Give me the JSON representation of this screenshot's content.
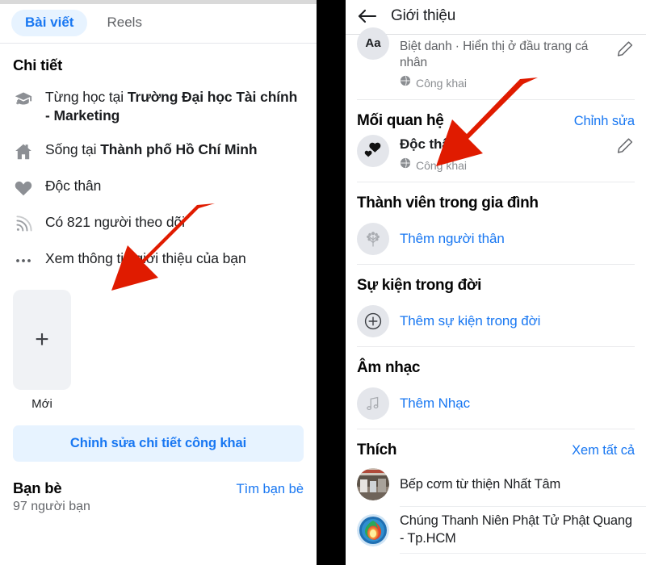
{
  "left": {
    "tabs": [
      {
        "label": "Bài viết",
        "active": true
      },
      {
        "label": "Reels",
        "active": false
      }
    ],
    "details_title": "Chi tiết",
    "details": [
      {
        "icon": "graduation-cap-icon",
        "prefix": "Từng học tại ",
        "strong": "Trường Đại học Tài chính - Marketing"
      },
      {
        "icon": "home-icon",
        "prefix": "Sống tại ",
        "strong": "Thành phố Hồ Chí Minh"
      },
      {
        "icon": "heart-icon",
        "prefix": "Độc thân",
        "strong": ""
      },
      {
        "icon": "rss-icon",
        "prefix": "Có 821 người theo dõi",
        "strong": ""
      },
      {
        "icon": "ellipsis-icon",
        "prefix": "Xem thông tin giới thiệu của bạn",
        "strong": ""
      }
    ],
    "new_card_label": "Mới",
    "edit_public_button": "Chỉnh sửa chi tiết công khai",
    "friends_title": "Bạn bè",
    "friends_count": "97 người bạn",
    "find_friends_link": "Tìm bạn bè"
  },
  "right": {
    "header_title": "Giới thiệu",
    "clipped_row": {
      "avatar_text": "Aa",
      "primary": "Biệt danh · Hiển thị ở đầu trang cá nhân",
      "privacy": "Công khai"
    },
    "relationship": {
      "title": "Mối quan hệ",
      "edit_link": "Chỉnh sửa",
      "status": "Độc thân",
      "privacy": "Công khai"
    },
    "family": {
      "title": "Thành viên trong gia đình",
      "add_link": "Thêm người thân"
    },
    "life_events": {
      "title": "Sự kiện trong đời",
      "add_link": "Thêm sự kiện trong đời"
    },
    "music": {
      "title": "Âm nhạc",
      "add_link": "Thêm Nhạc"
    },
    "likes": {
      "title": "Thích",
      "see_all_link": "Xem tất cả",
      "items": [
        {
          "name": "Bếp cơm từ thiện Nhất Tâm"
        },
        {
          "name": "Chúng Thanh Niên Phật Tử Phật Quang - Tp.HCM"
        }
      ]
    }
  },
  "annotations": {
    "arrow_color": "#e01b00",
    "arrows": [
      {
        "name": "arrow-pointing-to-see-about-info"
      },
      {
        "name": "arrow-pointing-to-add-music"
      }
    ]
  },
  "colors": {
    "accent_blue": "#1877f2",
    "pill_bg": "#e7f3ff",
    "divider_black": "#000000",
    "muted_text": "#65676b"
  }
}
